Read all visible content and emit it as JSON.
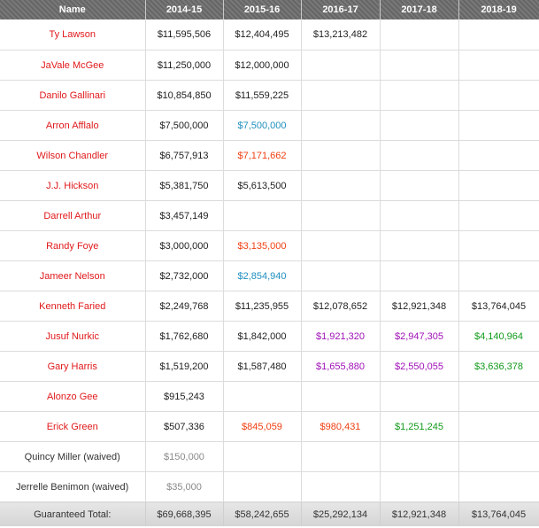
{
  "colors": {
    "header_bg": "#6e6e6e",
    "player_name": "#e0191b",
    "team_option": "#1f8fbf",
    "player_option": "#f04012",
    "rookie_option": "#a010b8",
    "qualifying_offer": "#119a1b",
    "waived_amount": "#8a8a8a"
  },
  "table": {
    "headers": [
      "Name",
      "2014-15",
      "2015-16",
      "2016-17",
      "2017-18",
      "2018-19"
    ],
    "rows": [
      {
        "name": "Ty Lawson",
        "name_type": "player",
        "cells": [
          {
            "value": "$11,595,506",
            "type": "normal"
          },
          {
            "value": "$12,404,495",
            "type": "normal"
          },
          {
            "value": "$13,213,482",
            "type": "normal"
          },
          {
            "value": "",
            "type": "normal"
          },
          {
            "value": "",
            "type": "normal"
          }
        ]
      },
      {
        "name": "JaVale McGee",
        "name_type": "player",
        "cells": [
          {
            "value": "$11,250,000",
            "type": "normal"
          },
          {
            "value": "$12,000,000",
            "type": "normal"
          },
          {
            "value": "",
            "type": "normal"
          },
          {
            "value": "",
            "type": "normal"
          },
          {
            "value": "",
            "type": "normal"
          }
        ]
      },
      {
        "name": "Danilo Gallinari",
        "name_type": "player",
        "cells": [
          {
            "value": "$10,854,850",
            "type": "normal"
          },
          {
            "value": "$11,559,225",
            "type": "normal"
          },
          {
            "value": "",
            "type": "normal"
          },
          {
            "value": "",
            "type": "normal"
          },
          {
            "value": "",
            "type": "normal"
          }
        ]
      },
      {
        "name": "Arron Afflalo",
        "name_type": "player",
        "cells": [
          {
            "value": "$7,500,000",
            "type": "normal"
          },
          {
            "value": "$7,500,000",
            "type": "team-option"
          },
          {
            "value": "",
            "type": "normal"
          },
          {
            "value": "",
            "type": "normal"
          },
          {
            "value": "",
            "type": "normal"
          }
        ]
      },
      {
        "name": "Wilson Chandler",
        "name_type": "player",
        "cells": [
          {
            "value": "$6,757,913",
            "type": "normal"
          },
          {
            "value": "$7,171,662",
            "type": "player-option"
          },
          {
            "value": "",
            "type": "normal"
          },
          {
            "value": "",
            "type": "normal"
          },
          {
            "value": "",
            "type": "normal"
          }
        ]
      },
      {
        "name": "J.J. Hickson",
        "name_type": "player",
        "cells": [
          {
            "value": "$5,381,750",
            "type": "normal"
          },
          {
            "value": "$5,613,500",
            "type": "normal"
          },
          {
            "value": "",
            "type": "normal"
          },
          {
            "value": "",
            "type": "normal"
          },
          {
            "value": "",
            "type": "normal"
          }
        ]
      },
      {
        "name": "Darrell Arthur",
        "name_type": "player",
        "cells": [
          {
            "value": "$3,457,149",
            "type": "normal"
          },
          {
            "value": "",
            "type": "normal"
          },
          {
            "value": "",
            "type": "normal"
          },
          {
            "value": "",
            "type": "normal"
          },
          {
            "value": "",
            "type": "normal"
          }
        ]
      },
      {
        "name": "Randy Foye",
        "name_type": "player",
        "cells": [
          {
            "value": "$3,000,000",
            "type": "normal"
          },
          {
            "value": "$3,135,000",
            "type": "player-option"
          },
          {
            "value": "",
            "type": "normal"
          },
          {
            "value": "",
            "type": "normal"
          },
          {
            "value": "",
            "type": "normal"
          }
        ]
      },
      {
        "name": "Jameer Nelson",
        "name_type": "player",
        "cells": [
          {
            "value": "$2,732,000",
            "type": "normal"
          },
          {
            "value": "$2,854,940",
            "type": "team-option"
          },
          {
            "value": "",
            "type": "normal"
          },
          {
            "value": "",
            "type": "normal"
          },
          {
            "value": "",
            "type": "normal"
          }
        ]
      },
      {
        "name": "Kenneth Faried",
        "name_type": "player",
        "cells": [
          {
            "value": "$2,249,768",
            "type": "normal"
          },
          {
            "value": "$11,235,955",
            "type": "normal"
          },
          {
            "value": "$12,078,652",
            "type": "normal"
          },
          {
            "value": "$12,921,348",
            "type": "normal"
          },
          {
            "value": "$13,764,045",
            "type": "normal"
          }
        ]
      },
      {
        "name": "Jusuf Nurkic",
        "name_type": "player",
        "cells": [
          {
            "value": "$1,762,680",
            "type": "normal"
          },
          {
            "value": "$1,842,000",
            "type": "normal"
          },
          {
            "value": "$1,921,320",
            "type": "rookie-option"
          },
          {
            "value": "$2,947,305",
            "type": "rookie-option"
          },
          {
            "value": "$4,140,964",
            "type": "qualifying-offer"
          }
        ]
      },
      {
        "name": "Gary Harris",
        "name_type": "player",
        "cells": [
          {
            "value": "$1,519,200",
            "type": "normal"
          },
          {
            "value": "$1,587,480",
            "type": "normal"
          },
          {
            "value": "$1,655,880",
            "type": "rookie-option"
          },
          {
            "value": "$2,550,055",
            "type": "rookie-option"
          },
          {
            "value": "$3,636,378",
            "type": "qualifying-offer"
          }
        ]
      },
      {
        "name": "Alonzo Gee",
        "name_type": "player",
        "cells": [
          {
            "value": "$915,243",
            "type": "normal"
          },
          {
            "value": "",
            "type": "normal"
          },
          {
            "value": "",
            "type": "normal"
          },
          {
            "value": "",
            "type": "normal"
          },
          {
            "value": "",
            "type": "normal"
          }
        ]
      },
      {
        "name": "Erick Green",
        "name_type": "player",
        "cells": [
          {
            "value": "$507,336",
            "type": "normal"
          },
          {
            "value": "$845,059",
            "type": "player-option"
          },
          {
            "value": "$980,431",
            "type": "player-option"
          },
          {
            "value": "$1,251,245",
            "type": "qualifying-offer"
          },
          {
            "value": "",
            "type": "normal"
          }
        ]
      },
      {
        "name": "Quincy Miller (waived)",
        "name_type": "waived",
        "cells": [
          {
            "value": "$150,000",
            "type": "muted"
          },
          {
            "value": "",
            "type": "normal"
          },
          {
            "value": "",
            "type": "normal"
          },
          {
            "value": "",
            "type": "normal"
          },
          {
            "value": "",
            "type": "normal"
          }
        ]
      },
      {
        "name": "Jerrelle Benimon (waived)",
        "name_type": "waived",
        "cells": [
          {
            "value": "$35,000",
            "type": "muted"
          },
          {
            "value": "",
            "type": "normal"
          },
          {
            "value": "",
            "type": "normal"
          },
          {
            "value": "",
            "type": "normal"
          },
          {
            "value": "",
            "type": "normal"
          }
        ]
      }
    ],
    "footer": {
      "label": "Guaranteed Total:",
      "values": [
        "$69,668,395",
        "$58,242,655",
        "$25,292,134",
        "$12,921,348",
        "$13,764,045"
      ]
    }
  }
}
